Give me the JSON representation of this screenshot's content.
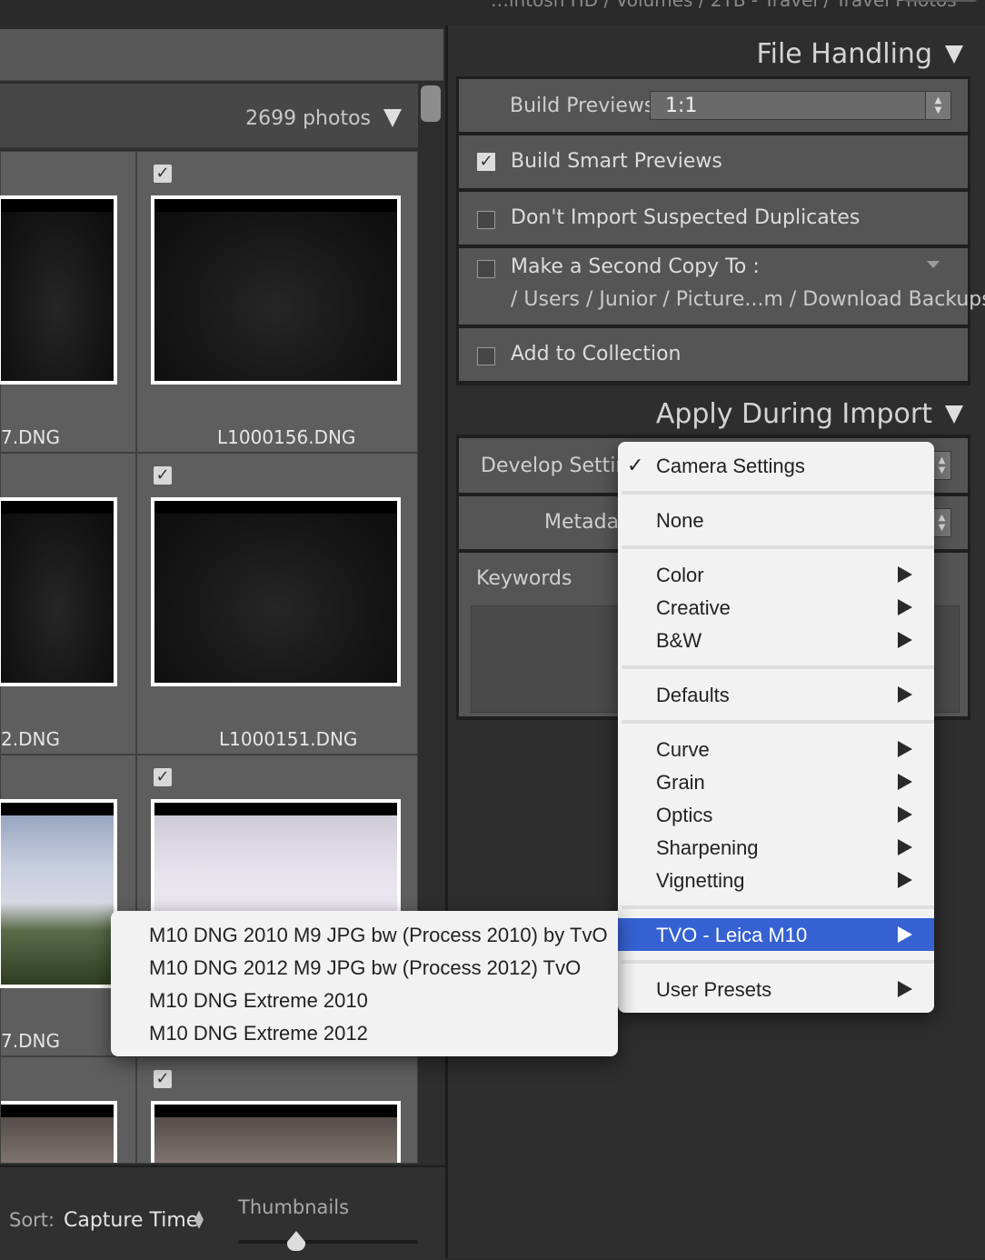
{
  "topbar": {
    "path": "…intosh HD / Volumes / 2TB - Travel / Travel Photos"
  },
  "grid": {
    "photo_count": "2699 photos",
    "cells": [
      {
        "filename": "7.DNG"
      },
      {
        "filename": "L1000156.DNG"
      },
      {
        "filename": "2.DNG"
      },
      {
        "filename": "L1000151.DNG"
      },
      {
        "filename": "7.DNG"
      }
    ]
  },
  "bottombar": {
    "sort_label": "Sort:",
    "sort_value": "Capture Time",
    "thumbnails_label": "Thumbnails"
  },
  "file_handling": {
    "title": "File Handling",
    "build_previews_label": "Build Previews",
    "build_previews_value": "1:1",
    "build_smart_previews": "Build Smart Previews",
    "dont_import_duplicates": "Don't Import Suspected Duplicates",
    "second_copy": "Make a Second Copy To :",
    "second_copy_path": "/ Users / Junior / Picture...m / Download Backups",
    "add_to_collection": "Add to Collection"
  },
  "apply_during_import": {
    "title": "Apply During Import",
    "develop_settings_label": "Develop Setting",
    "metadata_label": "Metadat",
    "keywords_label": "Keywords"
  },
  "develop_menu": {
    "items": [
      {
        "label": "Camera Settings",
        "checked": true
      },
      {
        "label": "None"
      },
      {
        "label": "Color"
      },
      {
        "label": "Creative"
      },
      {
        "label": "B&W"
      },
      {
        "label": "Defaults"
      },
      {
        "label": "Curve"
      },
      {
        "label": "Grain"
      },
      {
        "label": "Optics"
      },
      {
        "label": "Sharpening"
      },
      {
        "label": "Vignetting"
      },
      {
        "label": "TVO - Leica M10",
        "selected": true
      },
      {
        "label": "User Presets"
      }
    ],
    "checkmark": "✓"
  },
  "tvo_submenu": {
    "items": [
      "M10 DNG 2010 M9 JPG bw (Process 2010) by TvO",
      "M10 DNG 2012 M9 JPG bw (Process 2012) TvO",
      "M10 DNG Extreme 2010",
      "M10 DNG Extreme 2012"
    ]
  },
  "colors": {
    "menu_highlight": "#3561d3",
    "panel_bg": "#555555",
    "app_bg": "#2b2b2b"
  }
}
